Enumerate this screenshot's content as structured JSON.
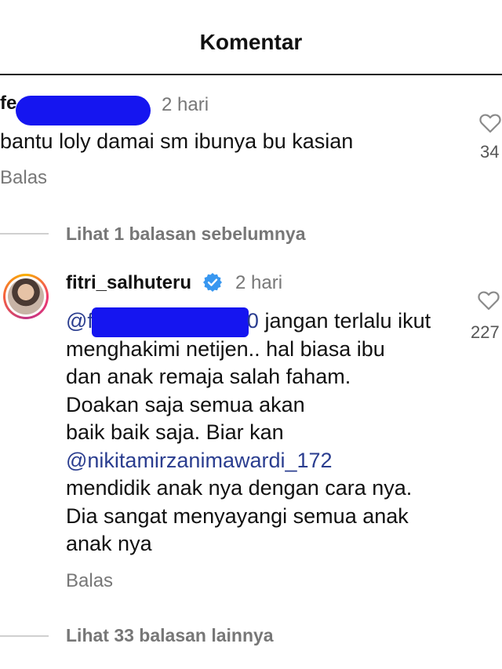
{
  "header": {
    "title": "Komentar"
  },
  "comment": {
    "username_visible": "fe",
    "time": "2 hari",
    "text": "bantu loly damai sm ibunya bu kasian",
    "reply_label": "Balas",
    "likes": "34"
  },
  "view_previous": "Lihat 1 balasan sebelumnya",
  "reply": {
    "username": "fitri_salhuteru",
    "time": "2 hari",
    "mention_start": "@f",
    "mention_end": "0",
    "line1_rest": " jangan terlalu ikut",
    "lines": [
      "menghakimi netijen.. hal biasa ibu",
      "dan anak remaja salah faham.",
      "Doakan saja semua akan",
      "baik baik saja. Biar kan"
    ],
    "mention2": "@nikitamirzanimawardi_172",
    "lines_after": [
      "mendidik anak nya dengan cara nya.",
      "Dia sangat menyayangi semua anak",
      "anak nya"
    ],
    "reply_label": "Balas",
    "likes": "227"
  },
  "view_more": "Lihat 33 balasan lainnya",
  "colors": {
    "redaction": "#1515f0",
    "verified": "#3897f0",
    "muted": "#777777",
    "mention": "#2a3d8f"
  },
  "icons": {
    "like": "heart-outline-icon",
    "verified": "verified-badge-icon"
  }
}
